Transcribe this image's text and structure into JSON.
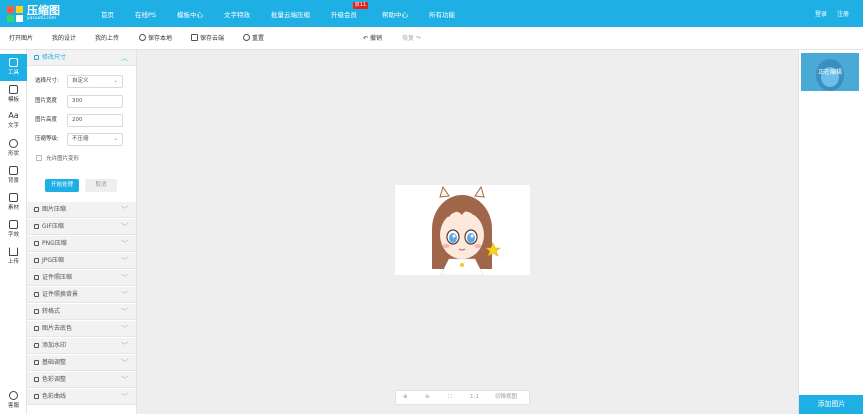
{
  "brand": {
    "name": "压缩图",
    "domain": "yasuotu.com"
  },
  "nav": {
    "items": [
      "首页",
      "在线PS",
      "模板中心",
      "文字特效",
      "批量云端压缩",
      "升级会员",
      "帮助中心",
      "所有功能"
    ],
    "vip_badge": "双11",
    "login": "登录",
    "register": "注册"
  },
  "toolbar": {
    "open": "打开图片",
    "my_designs": "我的设计",
    "my_uploads": "我的上传",
    "save_local": "保存本地",
    "save_cloud": "保存云端",
    "reset": "重置",
    "undo": "撤销",
    "redo": "恢复"
  },
  "rail": {
    "items": [
      "工具",
      "模板",
      "文字",
      "形状",
      "背景",
      "素材",
      "字效",
      "上传"
    ],
    "customer_service": "客服",
    "text_glyph": "Aa"
  },
  "panel": {
    "active_section": "修改尺寸",
    "size_label": "选择尺寸:",
    "size_value": "自定义",
    "width_label": "图片宽度",
    "width_value": "300",
    "height_label": "图片高度",
    "height_value": "200",
    "compress_label": "压缩等级:",
    "compress_value": "不压缩",
    "allow_deform": "允许图片变形",
    "start_button": "开始处理",
    "cancel_button": "取消",
    "sections": [
      "图片压缩",
      "GIF压缩",
      "PNG压缩",
      "JPG压缩",
      "证件照压缩",
      "证件照换背景",
      "转格式",
      "图片去底色",
      "添加水印",
      "基础调整",
      "色彩调整",
      "色彩曲线"
    ]
  },
  "zoom": {
    "ratio": "1:1",
    "switch_view": "切换视图"
  },
  "right_panel": {
    "thumb_label": "正在编辑",
    "add_button": "添加图片"
  },
  "colors": {
    "accent": "#1eb0e4",
    "badge": "#e0231b"
  }
}
